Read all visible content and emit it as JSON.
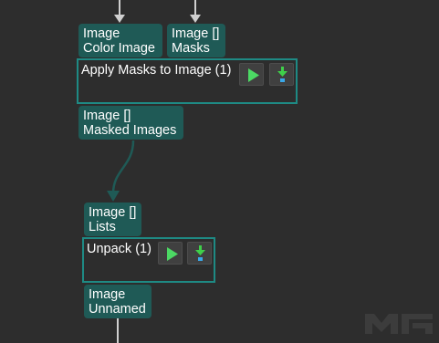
{
  "apply_masks": {
    "inputs": [
      {
        "type": "Image",
        "name": "Color Image"
      },
      {
        "type": "Image []",
        "name": "Masks"
      }
    ],
    "title": "Apply Masks to Image (1)",
    "outputs": [
      {
        "type": "Image []",
        "name": "Masked Images"
      }
    ]
  },
  "unpack": {
    "inputs": [
      {
        "type": "Image []",
        "name": "Lists"
      }
    ],
    "title": "Unpack (1)",
    "outputs": [
      {
        "type": "Image",
        "name": "Unnamed"
      }
    ]
  },
  "watermark": {
    "icon": "mech-mind-logo",
    "text": "MECH MIND"
  },
  "colors": {
    "background": "#2d2d2d",
    "port_fill": "#1f5a56",
    "step_border": "#1e8a84",
    "wire": "#1f5a56",
    "wire_input": "#d0d0d0",
    "run_icon": "#4cd964",
    "debug_icon": "#3fd04a"
  }
}
